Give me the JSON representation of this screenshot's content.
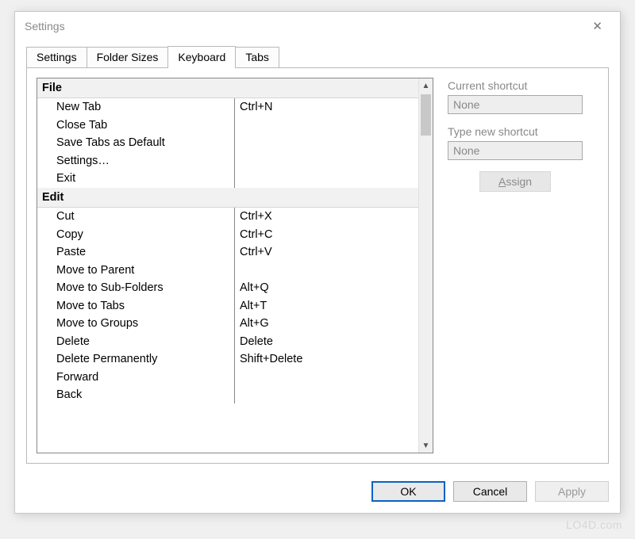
{
  "window": {
    "title": "Settings"
  },
  "tabs": [
    {
      "label": "Settings",
      "active": false
    },
    {
      "label": "Folder Sizes",
      "active": false
    },
    {
      "label": "Keyboard",
      "active": true
    },
    {
      "label": "Tabs",
      "active": false
    }
  ],
  "shortcut_groups": [
    {
      "name": "File",
      "items": [
        {
          "command": "New Tab",
          "shortcut": "Ctrl+N"
        },
        {
          "command": "Close Tab",
          "shortcut": ""
        },
        {
          "command": "Save Tabs as Default",
          "shortcut": ""
        },
        {
          "command": "Settings…",
          "shortcut": ""
        },
        {
          "command": "Exit",
          "shortcut": ""
        }
      ]
    },
    {
      "name": "Edit",
      "items": [
        {
          "command": "Cut",
          "shortcut": "Ctrl+X"
        },
        {
          "command": "Copy",
          "shortcut": "Ctrl+C"
        },
        {
          "command": "Paste",
          "shortcut": "Ctrl+V"
        },
        {
          "command": "Move to Parent",
          "shortcut": ""
        },
        {
          "command": "Move to Sub-Folders",
          "shortcut": "Alt+Q"
        },
        {
          "command": "Move to Tabs",
          "shortcut": "Alt+T"
        },
        {
          "command": "Move to Groups",
          "shortcut": "Alt+G"
        },
        {
          "command": "Delete",
          "shortcut": "Delete"
        },
        {
          "command": "Delete Permanently",
          "shortcut": "Shift+Delete"
        },
        {
          "command": "Forward",
          "shortcut": ""
        },
        {
          "command": "Back",
          "shortcut": ""
        }
      ]
    }
  ],
  "side": {
    "current_label": "Current shortcut",
    "current_value": "None",
    "new_label": "Type new shortcut",
    "new_value": "None",
    "assign_label": "Assign"
  },
  "footer": {
    "ok": "OK",
    "cancel": "Cancel",
    "apply": "Apply"
  },
  "watermark": "LO4D.com"
}
